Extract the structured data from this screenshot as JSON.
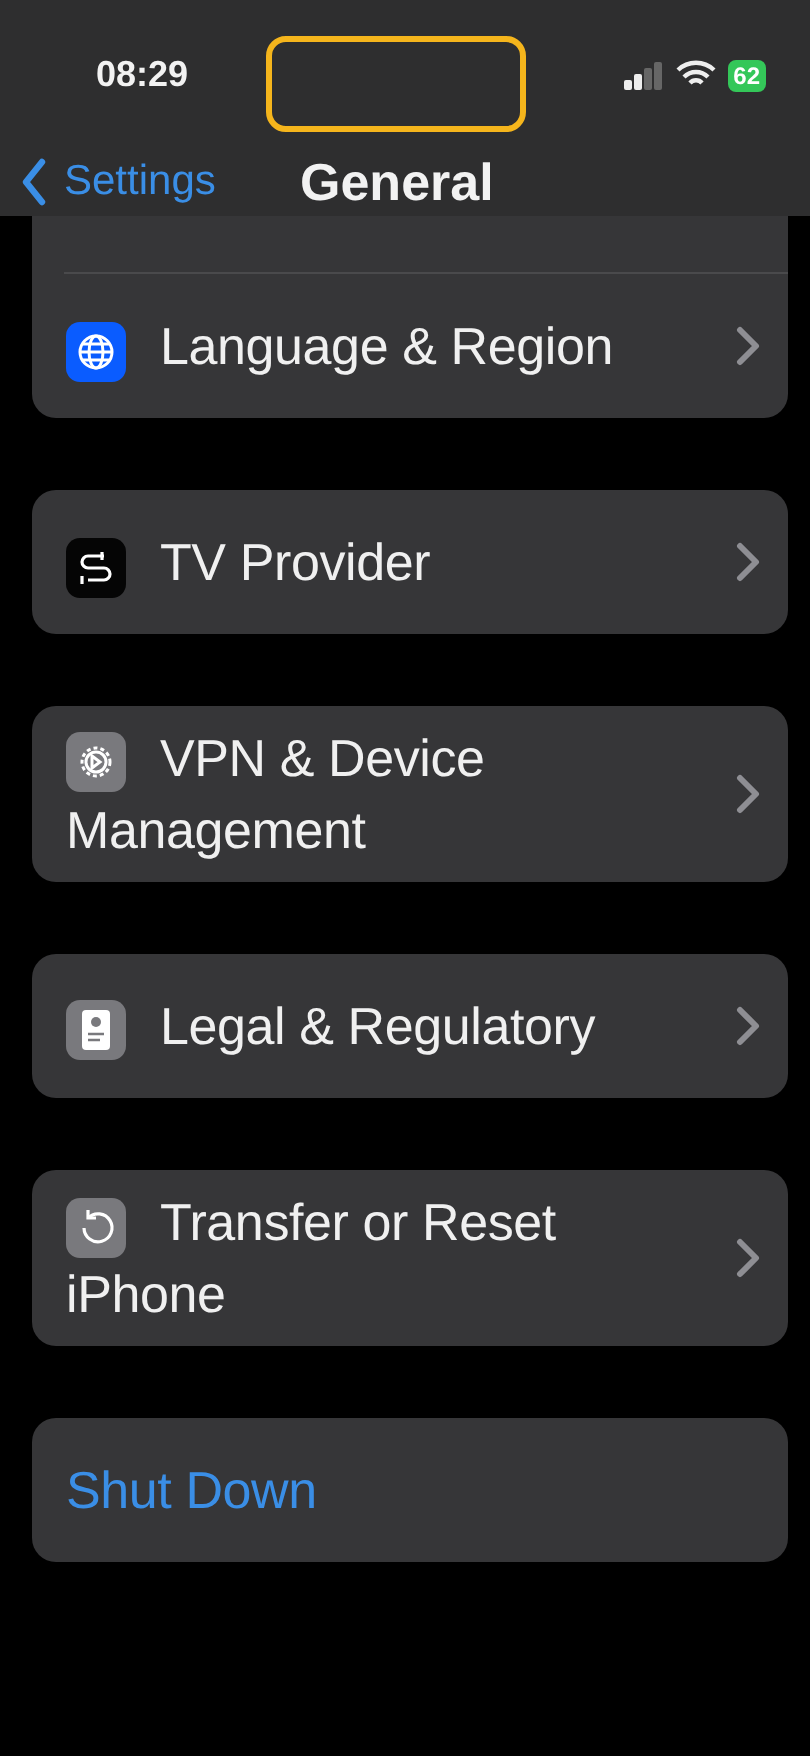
{
  "status_bar": {
    "time": "08:29",
    "battery": "62"
  },
  "nav": {
    "back": "Settings",
    "title": "General"
  },
  "groups": [
    {
      "partial_top": true,
      "items": [
        {
          "label": "Language & Region"
        }
      ]
    },
    {
      "items": [
        {
          "label": "TV Provider"
        }
      ]
    },
    {
      "items": [
        {
          "label": "VPN & Device Management"
        }
      ]
    },
    {
      "items": [
        {
          "label": "Legal & Regulatory"
        }
      ]
    },
    {
      "items": [
        {
          "label": "Transfer or Reset iPhone"
        }
      ]
    },
    {
      "items": [
        {
          "label": "Shut Down",
          "kind": "action"
        }
      ]
    }
  ]
}
